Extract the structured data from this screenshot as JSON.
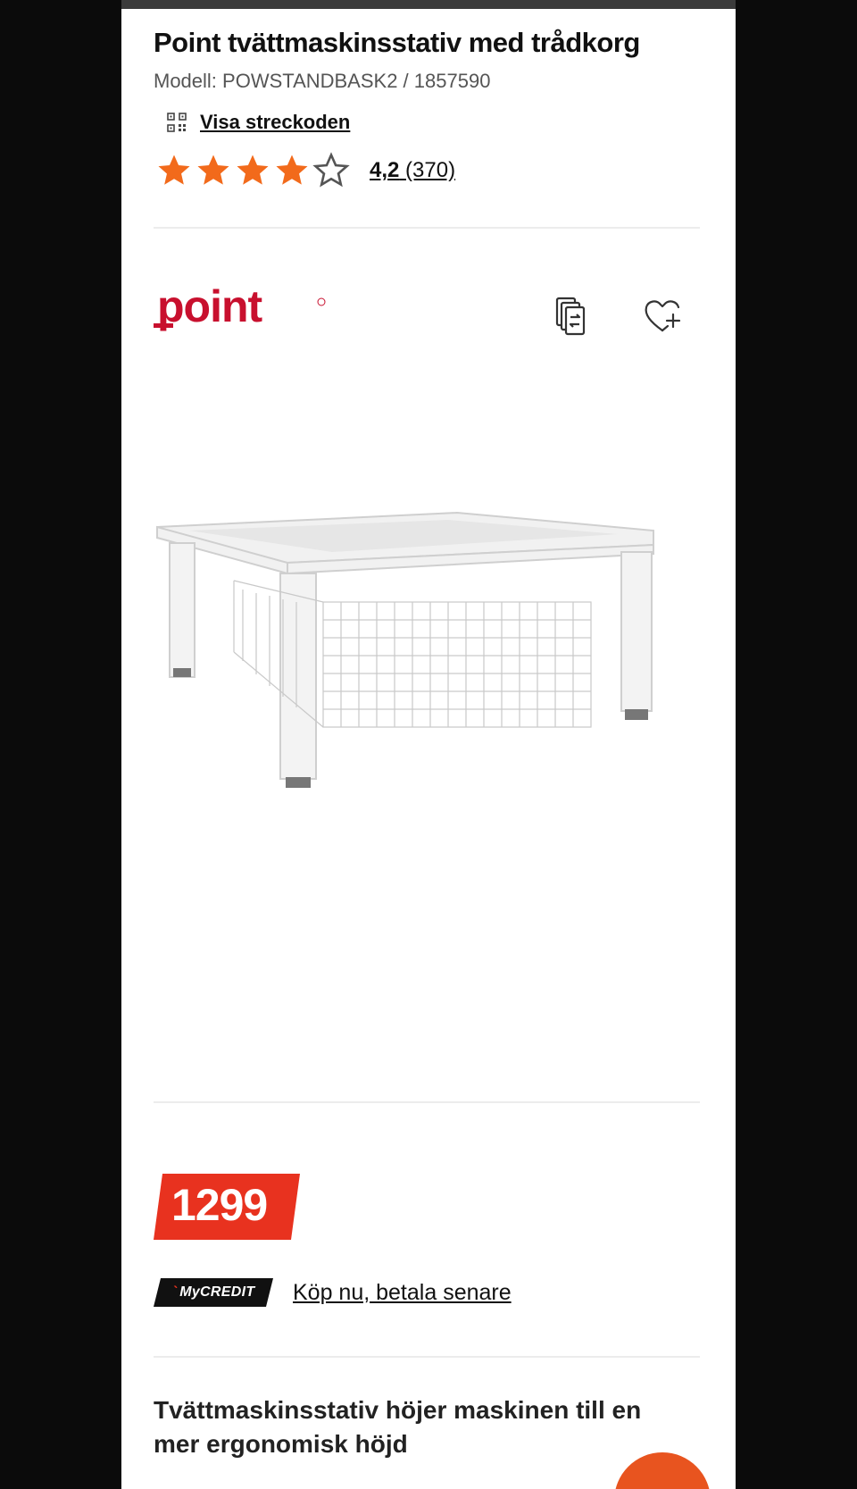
{
  "product": {
    "title": "Point tvättmaskinsstativ med trådkorg",
    "model": "Modell: POWSTANDBASK2 / 1857590",
    "barcode_link": "Visa streckoden",
    "rating": {
      "value": "4,2",
      "count": "(370)",
      "stars": 4.2,
      "max_stars": 5
    },
    "brand": "point",
    "price": "1299",
    "mycredit": {
      "badge_text": "MyCREDIT",
      "link": "Köp nu, betala senare"
    },
    "description": "Tvättmaskinsstativ höjer maskinen till en mer ergonomisk höjd"
  },
  "icons": {
    "barcode": "qr-code-icon",
    "star_full": "star-icon",
    "star_empty": "star-outline-icon",
    "compare": "compare-icon",
    "wishlist": "heart-plus-icon",
    "chat": "chat-icon"
  },
  "colors": {
    "star": "#f26a1b",
    "price_bg": "#e8321f",
    "brand_red": "#c8102e",
    "fab": "#e8541f"
  }
}
